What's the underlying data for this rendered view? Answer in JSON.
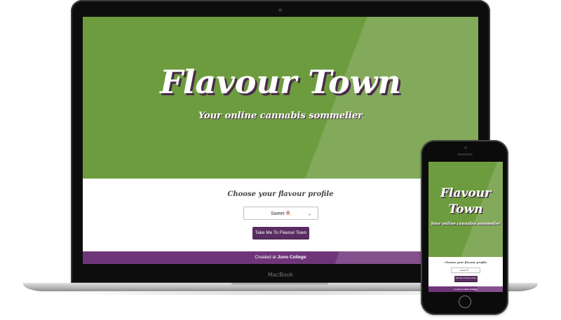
{
  "site": {
    "title": "Flavour Town",
    "subtitle": "Your online cannabis sommelier",
    "form_heading": "Choose your flavour profile",
    "select_value": "Sweet 🍭",
    "submit_label": "Take Me To Flavour Town",
    "footer_prefix": "Created at ",
    "footer_link": "Juno College"
  },
  "device": {
    "laptop_label": "MacBook"
  },
  "colors": {
    "hero_green": "#6d9c3f",
    "accent_purple": "#5a2d62",
    "footer_purple": "#6f3579"
  },
  "icons": {
    "select_chevron": "double-chevron-down-icon"
  }
}
